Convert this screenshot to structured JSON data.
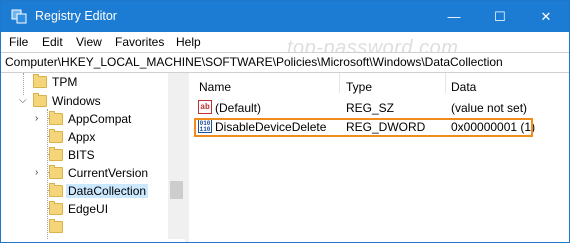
{
  "window": {
    "title": "Registry Editor"
  },
  "titlebar": {
    "minimize_glyph": "—",
    "maximize_glyph": "☐",
    "close_glyph": "✕"
  },
  "menu": {
    "items": [
      "File",
      "Edit",
      "View",
      "Favorites",
      "Help"
    ]
  },
  "watermark": "top-password.com",
  "address": {
    "path": "Computer\\HKEY_LOCAL_MACHINE\\SOFTWARE\\Policies\\Microsoft\\Windows\\DataCollection"
  },
  "tree": {
    "items": [
      {
        "label": "TPM"
      },
      {
        "label": "Windows",
        "expanded": true
      },
      {
        "label": "AppCompat"
      },
      {
        "label": "Appx"
      },
      {
        "label": "BITS"
      },
      {
        "label": "CurrentVersion"
      },
      {
        "label": "DataCollection",
        "selected": true
      },
      {
        "label": "EdgeUI"
      }
    ]
  },
  "list": {
    "columns": [
      "Name",
      "Type",
      "Data"
    ],
    "rows": [
      {
        "name": "(Default)",
        "type": "REG_SZ",
        "data": "(value not set)",
        "icon": "string-value-icon"
      },
      {
        "name": "DisableDeviceDelete",
        "type": "REG_DWORD",
        "data": "0x00000001 (1)",
        "icon": "dword-value-icon",
        "highlighted": true
      }
    ]
  },
  "colors": {
    "titlebar": "#1c7bd3",
    "highlight": "#f08c1c",
    "selection": "#cce8ff"
  }
}
